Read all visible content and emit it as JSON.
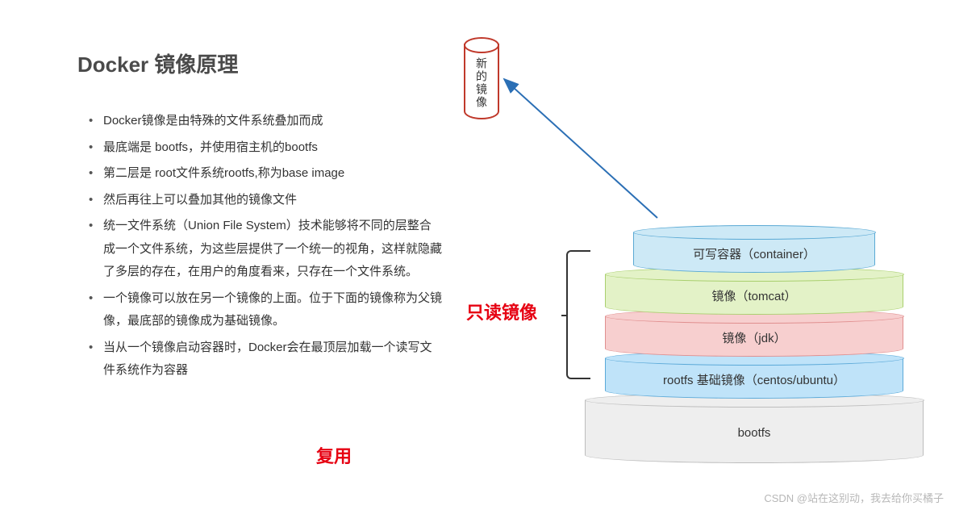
{
  "title": "Docker 镜像原理",
  "bullets": {
    "b1": "Docker镜像是由特殊的文件系统叠加而成",
    "b2": "最底端是 bootfs，并使用宿主机的bootfs",
    "b3": "第二层是 root文件系统rootfs,称为base image",
    "b4": "然后再往上可以叠加其他的镜像文件",
    "b5": "统一文件系统（Union File System）技术能够将不同的层整合成一个文件系统，为这些层提供了一个统一的视角，这样就隐藏了多层的存在，在用户的角度看来，只存在一个文件系统。",
    "b6": "一个镜像可以放在另一个镜像的上面。位于下面的镜像称为父镜像，最底部的镜像成为基础镜像。",
    "b7": "当从一个镜像启动容器时，Docker会在最顶层加载一个读写文件系统作为容器"
  },
  "labels": {
    "reuse": "复用",
    "readonly": "只读镜像",
    "new_image": "新的镜像"
  },
  "layers": {
    "container": "可写容器（container）",
    "tomcat": "镜像（tomcat）",
    "jdk": "镜像（jdk）",
    "rootfs": "rootfs 基础镜像（centos/ubuntu）",
    "bootfs": "bootfs"
  },
  "watermark": "CSDN @站在这别动，我去给你买橘子"
}
